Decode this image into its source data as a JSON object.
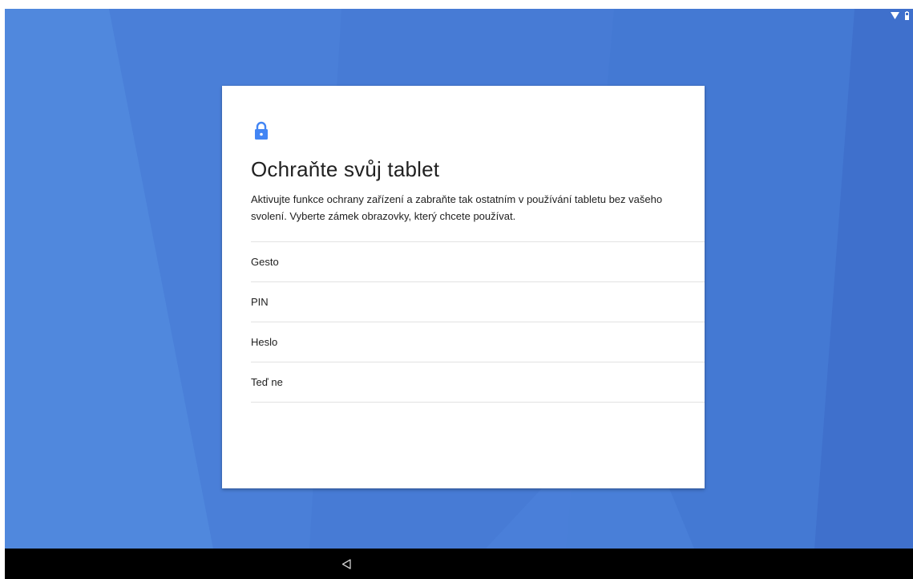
{
  "colors": {
    "background": "#4a7fd8",
    "accent": "#4285f4",
    "card": "#ffffff",
    "nav_bar": "#000000",
    "text": "#212121",
    "divider": "#e2e2e2"
  },
  "status_bar": {
    "icons": [
      "wifi-icon",
      "battery-icon"
    ]
  },
  "setup": {
    "icon": "lock-icon",
    "title": "Ochraňte svůj tablet",
    "description": "Aktivujte funkce ochrany zařízení a zabraňte tak ostatním v používání tabletu bez vašeho svolení. Vyberte zámek obrazovky, který chcete používat.",
    "options": [
      {
        "label": "Gesto"
      },
      {
        "label": "PIN"
      },
      {
        "label": "Heslo"
      },
      {
        "label": "Teď ne"
      }
    ]
  },
  "nav_bar": {
    "icons": [
      "back-icon"
    ]
  }
}
